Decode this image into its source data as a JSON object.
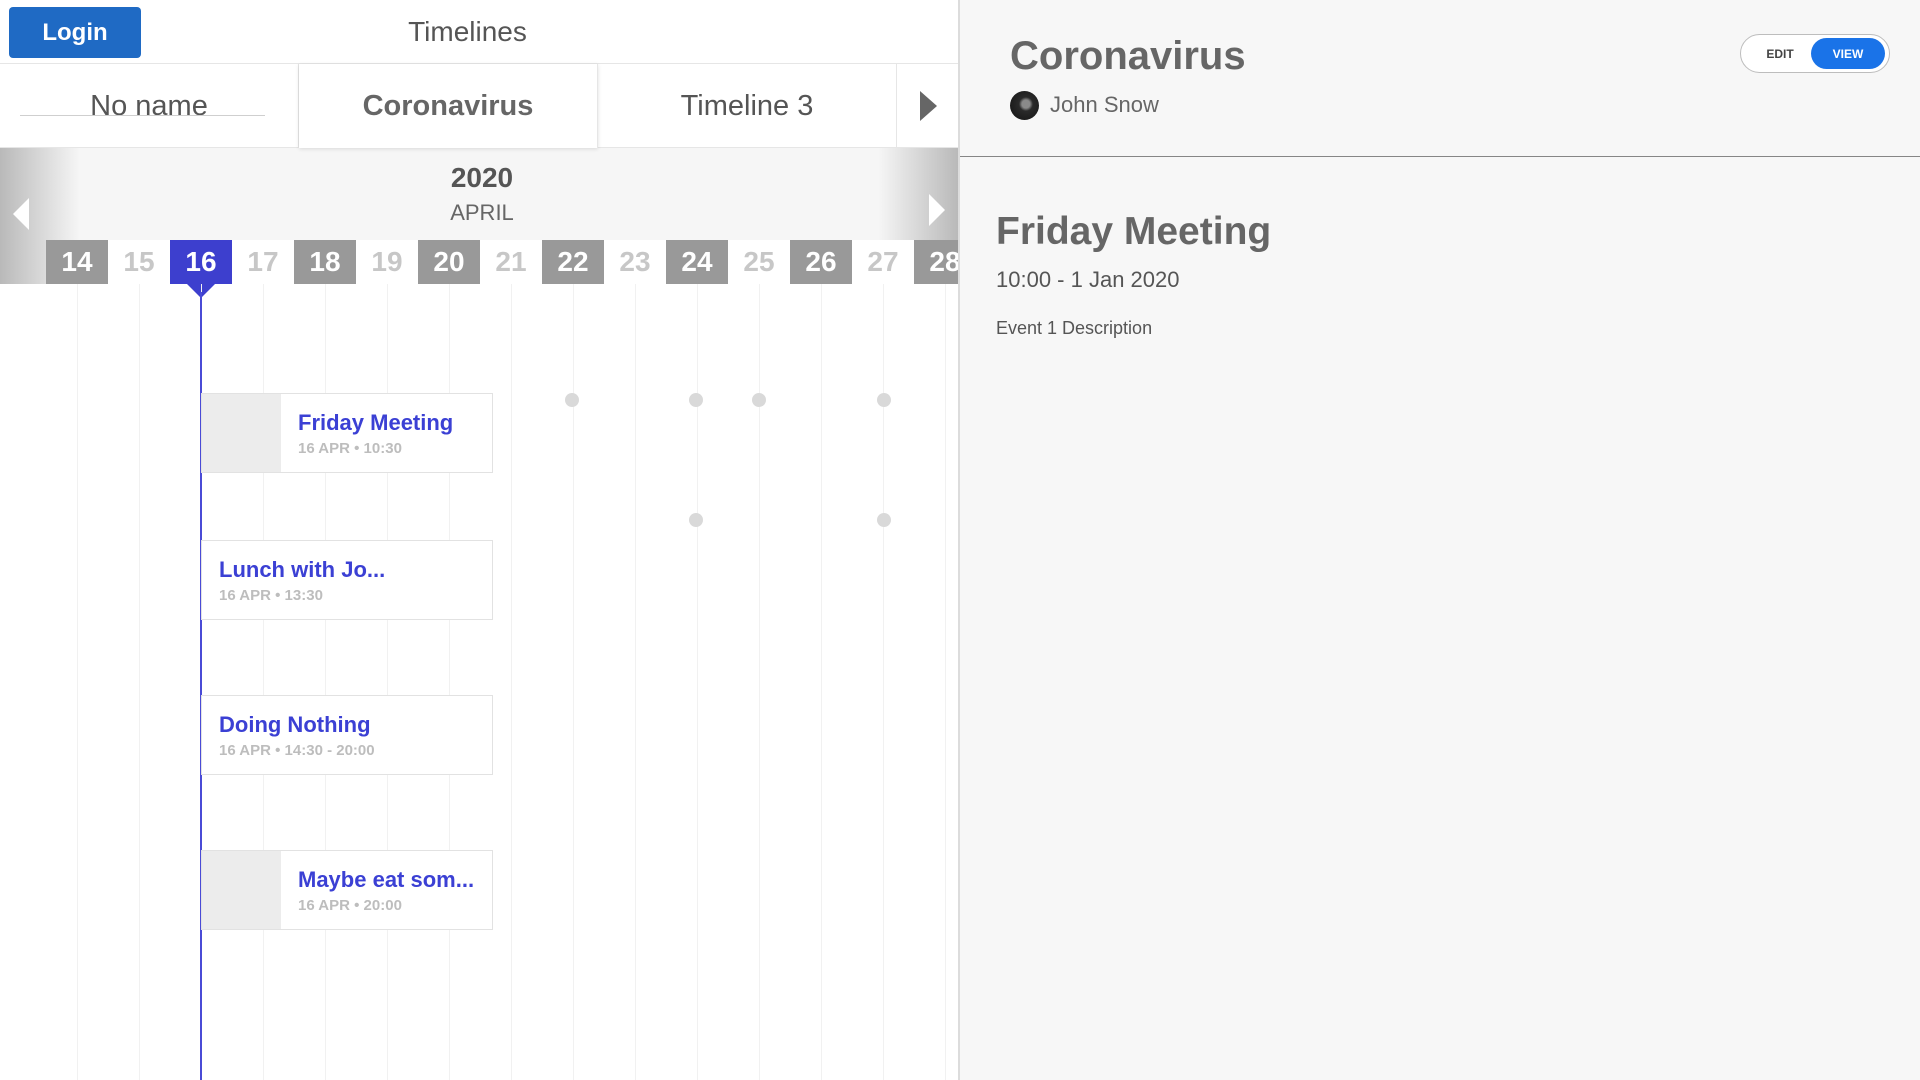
{
  "header": {
    "login_label": "Login",
    "app_title": "Timelines"
  },
  "tabs": [
    {
      "label": "No name",
      "active": false
    },
    {
      "label": "Coronavirus",
      "active": true
    },
    {
      "label": "Timeline 3",
      "active": false
    }
  ],
  "calendar": {
    "year": "2020",
    "month": "APRIL",
    "days": [
      {
        "label": "14",
        "style": "dark"
      },
      {
        "label": "15",
        "style": "light"
      },
      {
        "label": "16",
        "style": "selected"
      },
      {
        "label": "17",
        "style": "light"
      },
      {
        "label": "18",
        "style": "dark"
      },
      {
        "label": "19",
        "style": "light"
      },
      {
        "label": "20",
        "style": "dark"
      },
      {
        "label": "21",
        "style": "light"
      },
      {
        "label": "22",
        "style": "dark"
      },
      {
        "label": "23",
        "style": "light"
      },
      {
        "label": "24",
        "style": "dark"
      },
      {
        "label": "25",
        "style": "light"
      },
      {
        "label": "26",
        "style": "dark"
      },
      {
        "label": "27",
        "style": "light"
      },
      {
        "label": "28",
        "style": "dark"
      }
    ]
  },
  "events": [
    {
      "title": "Friday Meeting",
      "meta": "16 APR • 10:30",
      "has_image": true
    },
    {
      "title": "Lunch with Jo...",
      "meta": "16 APR • 13:30",
      "has_image": false
    },
    {
      "title": "Doing Nothing",
      "meta": "16 APR • 14:30 - 20:00",
      "has_image": false
    },
    {
      "title": "Maybe eat som...",
      "meta": "16 APR • 20:00",
      "has_image": true
    }
  ],
  "detail": {
    "timeline_title": "Coronavirus",
    "author": "John Snow",
    "mode_edit": "EDIT",
    "mode_view": "VIEW",
    "mode_selected": "VIEW",
    "event_title": "Friday Meeting",
    "event_time": "10:00 - 1 Jan 2020",
    "event_description": "Event 1 Description"
  },
  "colors": {
    "accent": "#3d3fce",
    "login_button": "#1f6ac4",
    "view_toggle": "#1a73e8",
    "event_title": "#3b40d4"
  }
}
